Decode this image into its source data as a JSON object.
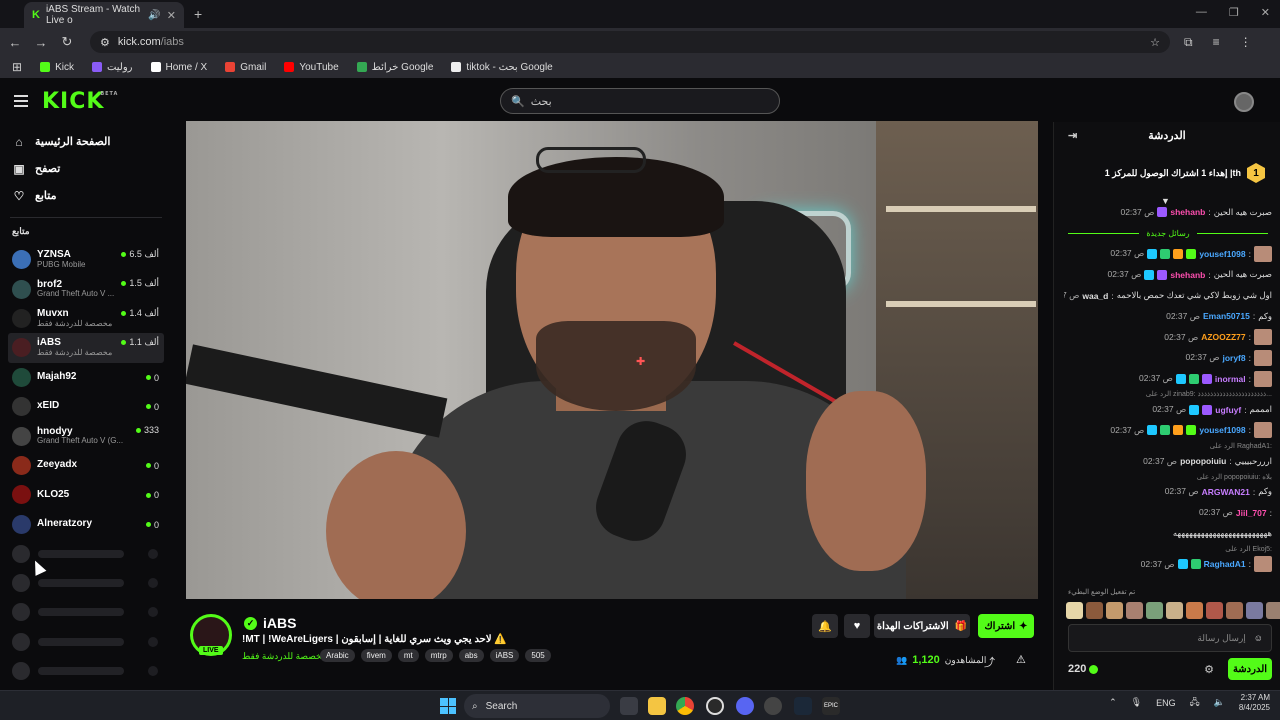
{
  "browser": {
    "tab_title": "iABS Stream - Watch Live o",
    "url_host": "kick.com",
    "url_path": "/iabs",
    "bookmarks": [
      {
        "label": "Kick",
        "color": "#53fc18"
      },
      {
        "label": "رولیت",
        "color": "#8a5cf6"
      },
      {
        "label": "Home / X",
        "color": "#ffffff"
      },
      {
        "label": "Gmail",
        "color": "#ea4335"
      },
      {
        "label": "YouTube",
        "color": "#ff0000"
      },
      {
        "label": "خرائط Google",
        "color": "#34a853"
      },
      {
        "label": "tiktok - بحث Google",
        "color": "#eeeeee"
      }
    ]
  },
  "header": {
    "logo": "KICK",
    "logo_beta": "BETA",
    "search_placeholder": "بحث"
  },
  "sidebar": {
    "nav": [
      {
        "label": "الصفحة الرئيسية",
        "icon": "home-icon"
      },
      {
        "label": "تصفح",
        "icon": "browse-icon"
      },
      {
        "label": "متابع",
        "icon": "heart-icon"
      }
    ],
    "following_heading": "متابع",
    "channels": [
      {
        "name": "YZNSA",
        "sub": "PUBG Mobile",
        "viewers": "6.5 ألف",
        "color": "#3b6fb6"
      },
      {
        "name": "brof2",
        "sub": "Grand Theft Auto V ...",
        "viewers": "1.5 ألف",
        "color": "#2f4f4f"
      },
      {
        "name": "Muvxn",
        "sub": "مخصصة للدردشة فقط",
        "viewers": "1.4 ألف",
        "color": "#222"
      },
      {
        "name": "iABS",
        "sub": "مخصصة للدردشة فقط",
        "viewers": "1.1 ألف",
        "color": "#4a1e22",
        "active": true
      },
      {
        "name": "Majah92",
        "sub": "",
        "viewers": "0",
        "color": "#1f4a3a"
      },
      {
        "name": "xEID",
        "sub": "",
        "viewers": "0",
        "color": "#333"
      },
      {
        "name": "hnodyy",
        "sub": "Grand Theft Auto V (G...",
        "viewers": "333",
        "color": "#444"
      },
      {
        "name": "Zeeyadx",
        "sub": "",
        "viewers": "0",
        "color": "#8a2a1a"
      },
      {
        "name": "KLO25",
        "sub": "",
        "viewers": "0",
        "color": "#7a1010"
      },
      {
        "name": "Alneratzory",
        "sub": "",
        "viewers": "0",
        "color": "#2a3a6a"
      }
    ],
    "placeholders": 5
  },
  "stream": {
    "streamer": "iABS",
    "live_label": "LIVE",
    "title": "!MT | !WeAreLigers | لاحد يجي ويث سري للغاية | إسابقون ⚠️",
    "category": "مخصصة للدردشة فقط",
    "tags": [
      "Arabic",
      "fivem",
      "mt",
      "mtrp",
      "abs",
      "iABS",
      "505"
    ],
    "subscribe_label": "اشتراك",
    "gift_label": "الاشتراكات الهداة",
    "viewers_label": "المشاهدون",
    "viewers_count": "1,120"
  },
  "chat": {
    "title": "الدردشة",
    "pinned_text": "إهداء 1 اشتراك الوصول للمركز 1 ‎|th",
    "pinned_rank": "1",
    "new_messages_label": "رسائل جديدة",
    "messages": [
      {
        "time": "02:37 ص",
        "user": "shehanb",
        "text": "صبرت هيه الحين",
        "color": "#ff4fb0",
        "badges": [
          "#9b59ff"
        ]
      },
      {
        "type": "new"
      },
      {
        "time": "02:37 ص",
        "user": "yousef1098",
        "text": "",
        "color": "#4aa8ff",
        "badges": [
          "#1ec8ff",
          "#2ecc71",
          "#ff9f1c",
          "#53fc18"
        ],
        "emote": true
      },
      {
        "time": "02:37 ص",
        "user": "shehanb",
        "text": "صبرت هيه الحين",
        "color": "#ff4fb0",
        "badges": [
          "#1ec8ff",
          "#9b59ff"
        ]
      },
      {
        "time": "02:37 ص",
        "user": "waa_d",
        "text": "اول شي زوبط لاكي شي تعدك حمص بالاحمه",
        "color": "#dddddd",
        "badges": []
      },
      {
        "time": "02:37 ص",
        "user": "Eman50715",
        "text": "وكم",
        "color": "#4aa8ff",
        "badges": []
      },
      {
        "time": "02:37 ص",
        "user": "AZOOZZ77",
        "text": "",
        "color": "#ff9f1c",
        "badges": [],
        "emote": true
      },
      {
        "time": "02:37 ص",
        "user": "joryf8",
        "text": "",
        "color": "#4aa8ff",
        "badges": [],
        "emote": true
      },
      {
        "time": "02:37 ص",
        "user": "inormal",
        "text": "",
        "color": "#c77dff",
        "badges": [
          "#1ec8ff",
          "#2ecc71",
          "#9b59ff"
        ],
        "emote": true
      },
      {
        "type": "reply",
        "text": "الرد على zinab9: ذذذذذذذذذذذذذذذذذذذذذذ..."
      },
      {
        "time": "02:37 ص",
        "user": "ugfuyf",
        "text": "امممم",
        "color": "#c77dff",
        "badges": [
          "#1ec8ff",
          "#9b59ff"
        ]
      },
      {
        "time": "02:37 ص",
        "user": "yousef1098",
        "text": "",
        "color": "#4aa8ff",
        "badges": [
          "#1ec8ff",
          "#2ecc71",
          "#ff9f1c",
          "#53fc18"
        ],
        "emote": true
      },
      {
        "type": "reply",
        "text": "الرد على RaghadA1:"
      },
      {
        "time": "02:37 ص",
        "user": "popopoiuiu",
        "text": "ارررحبيييي",
        "color": "#dddddd",
        "badges": []
      },
      {
        "type": "reply",
        "text": "الرد على popopoiuiu: بلاه"
      },
      {
        "time": "02:37 ص",
        "user": "ARGWAN21",
        "text": "وكم",
        "color": "#c77dff",
        "badges": []
      },
      {
        "time": "02:37 ص",
        "user": "Jiil_707",
        "text": "",
        "color": "#ff4fb0",
        "badges": []
      },
      {
        "time": "",
        "user": "",
        "text": "ههههههههههههههههههههههههه",
        "color": "#dddddd",
        "badges": []
      },
      {
        "type": "reply",
        "text": "الرد على Ekoj5:"
      },
      {
        "time": "02:37 ص",
        "user": "RaghadA1",
        "text": "",
        "color": "#4aa8ff",
        "badges": [
          "#1ec8ff",
          "#2ecc71"
        ],
        "emote": true
      }
    ],
    "emote_mode_note": "تم تفعيل الوضع البطيء",
    "input_placeholder": "إرسال رسالة",
    "points": "220",
    "chat_button": "الدردشة"
  },
  "taskbar": {
    "search_label": "Search",
    "lang": "ENG",
    "time": "2:37 AM",
    "date": "8/4/2025"
  }
}
